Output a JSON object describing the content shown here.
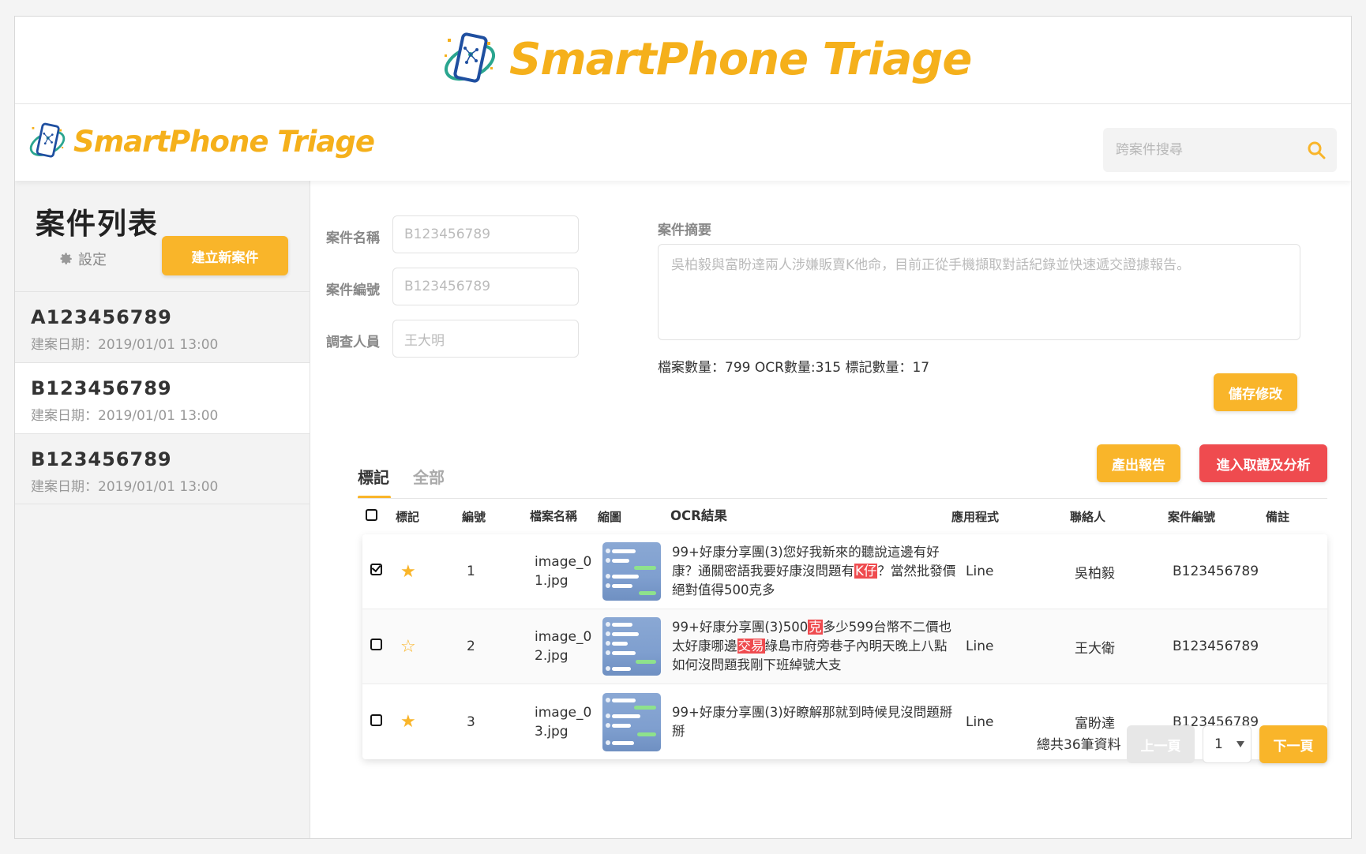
{
  "brand": {
    "name": "SmartPhone Triage",
    "accent": "#f9b52a",
    "danger": "#ef4b4f"
  },
  "header": {
    "search_placeholder": "跨案件搜尋",
    "search_icon": "search-icon"
  },
  "sidebar": {
    "title": "案件列表",
    "settings_label": "設定",
    "new_case_label": "建立新案件",
    "cases": [
      {
        "id": "A123456789",
        "date": "建案日期：2019/01/01 13:00"
      },
      {
        "id": "B123456789",
        "date": "建案日期：2019/01/01 13:00"
      },
      {
        "id": "B123456789",
        "date": "建案日期：2019/01/01 13:00"
      }
    ]
  },
  "form": {
    "name_label": "案件名稱",
    "name_value": "B123456789",
    "number_label": "案件編號",
    "number_value": "B123456789",
    "investigator_label": "調查人員",
    "investigator_value": "王大明",
    "summary_label": "案件摘要",
    "summary_value": "吳柏毅與富盼達兩人涉嫌販賣K他命，目前正從手機擷取對話紀錄並快速遞交證據報告。",
    "stats": "檔案數量：799 OCR數量:315 標記數量：17",
    "save_label": "儲存修改"
  },
  "actions": {
    "report_label": "產出報告",
    "analyze_label": "進入取證及分析"
  },
  "tabs": [
    {
      "label": "標記"
    },
    {
      "label": "全部"
    }
  ],
  "table": {
    "headers": {
      "mark": "標記",
      "num": "編號",
      "file": "檔案名稱",
      "thumb": "縮圖",
      "ocr": "OCR結果",
      "app": "應用程式",
      "contact": "聯絡人",
      "caseno": "案件編號",
      "note": "備註"
    },
    "rows": [
      {
        "checked": true,
        "star": "★",
        "num": "1",
        "file": "image_01.jpg",
        "ocr": {
          "pre": "99+好康分享團(3)您好我新來的聽說這邊有好康？通關密語我要好康沒問題有",
          "hl": "K仔",
          "post": "？當然批發價絕對值得500克多"
        },
        "app": "Line",
        "contact": "吳柏毅",
        "caseno": "B123456789",
        "note": ""
      },
      {
        "checked": false,
        "star": "☆",
        "num": "2",
        "file": "image_02.jpg",
        "ocr": {
          "pre": "99+好康分享團(3)500",
          "hl": "克",
          "mid": "多少599台幣不二價也太好康哪邊",
          "hl2": "交易",
          "post": "綠島市府旁巷子內明天晚上八點如何沒問題我剛下班綽號大支"
        },
        "app": "Line",
        "contact": "王大衛",
        "caseno": "B123456789",
        "note": ""
      },
      {
        "checked": false,
        "star": "★",
        "num": "3",
        "file": "image_03.jpg",
        "ocr": {
          "pre": "99+好康分享團(3)好瞭解那就到時候見沒問題掰掰",
          "hl": "",
          "post": ""
        },
        "app": "Line",
        "contact": "富盼達",
        "caseno": "B123456789",
        "note": ""
      }
    ]
  },
  "pagination": {
    "total": "總共36筆資料",
    "prev_label": "上一頁",
    "page": "1",
    "next_label": "下一頁"
  }
}
